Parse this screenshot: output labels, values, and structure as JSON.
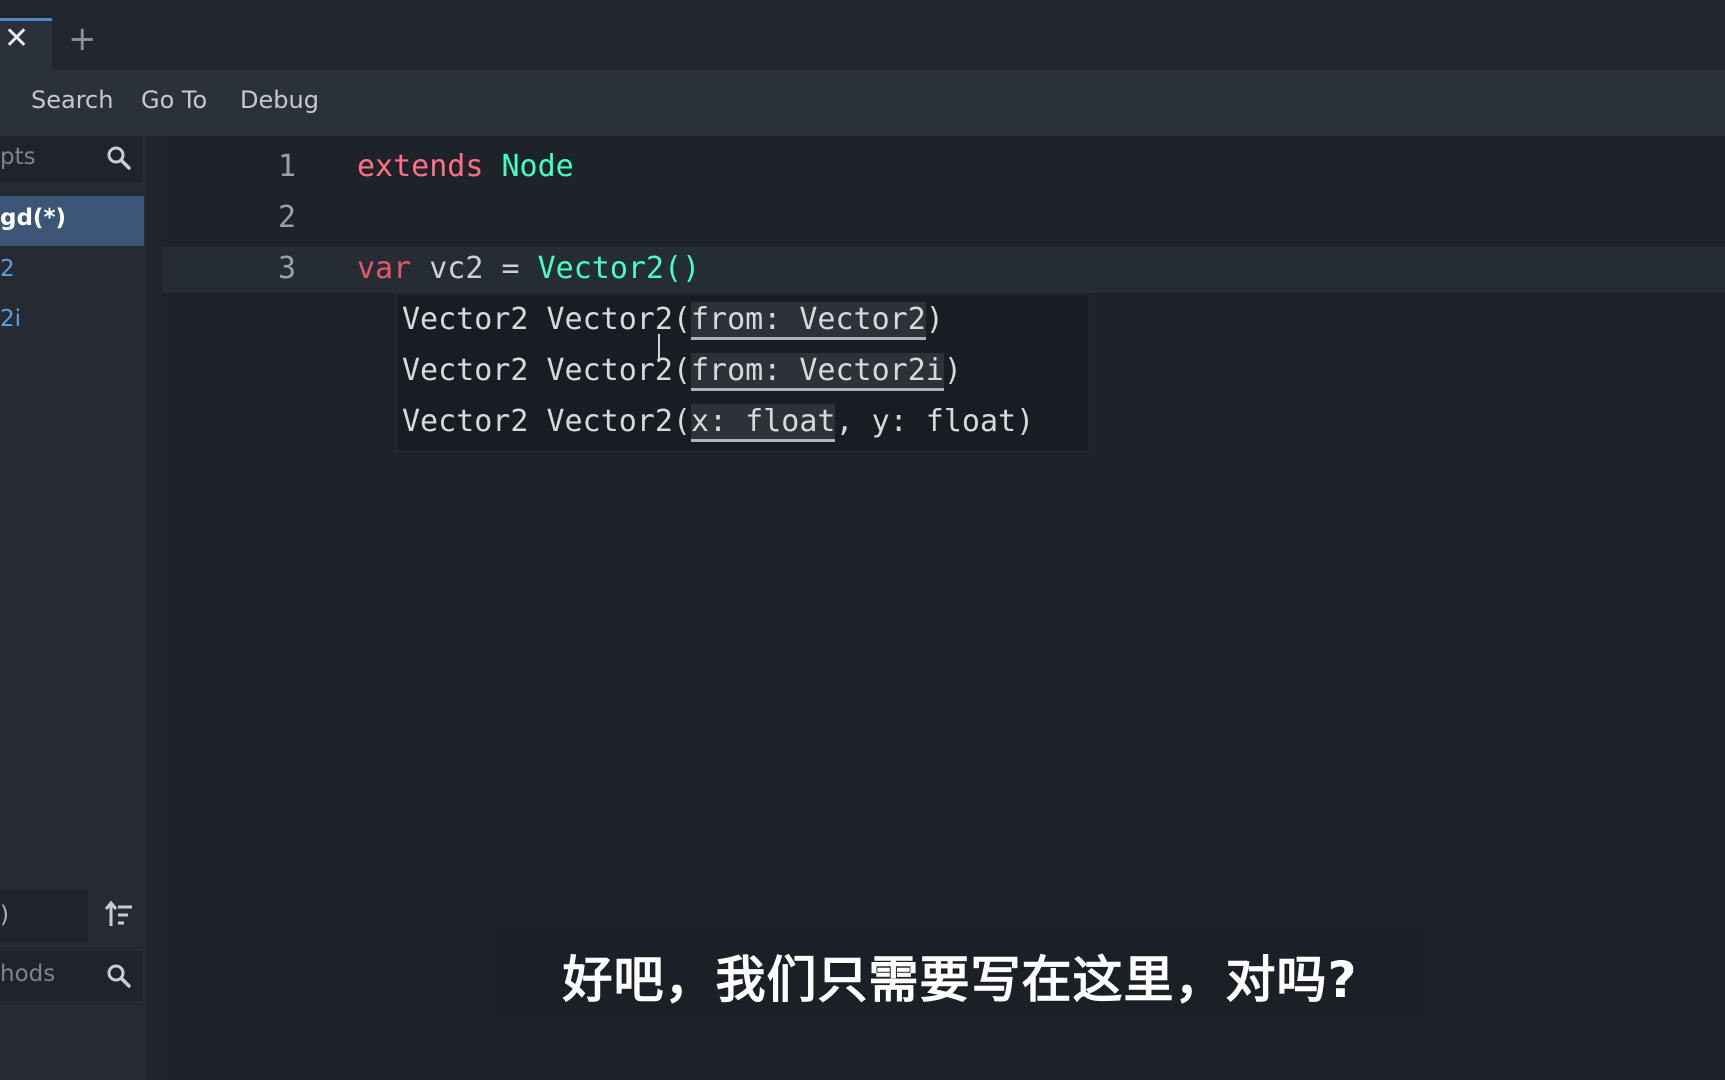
{
  "tabs": {
    "close_glyph": "✕",
    "add_glyph": "+"
  },
  "menu": {
    "items": [
      "Search",
      "Go To",
      "Debug"
    ]
  },
  "left_panel": {
    "scripts_filter": "pts",
    "scripts": [
      {
        "label": "gd(*)",
        "selected": true
      },
      {
        "label": "2",
        "selected": false
      },
      {
        "label": "2i",
        "selected": false
      }
    ],
    "bottom_field": ")",
    "methods_filter": "hods"
  },
  "editor": {
    "lines": [
      {
        "number": "1"
      },
      {
        "number": "2"
      },
      {
        "number": "3"
      }
    ],
    "line1": {
      "keyword": "extends",
      "type": "Node"
    },
    "line3": {
      "keyword": "var",
      "name": " vc2 = ",
      "call": "Vector2()"
    }
  },
  "tooltip": {
    "rows": [
      {
        "prefix": "Vector2 Vector2(",
        "arg": "from: Vector2",
        "rest": ")"
      },
      {
        "prefix": "Vector2 Vector2(",
        "arg": "from: Vector2i",
        "rest": ")"
      },
      {
        "prefix": "Vector2 Vector2(",
        "arg": "x: float",
        "rest": ", y: float)"
      }
    ]
  },
  "subtitle": "好吧，我们只需要写在这里，对吗?",
  "colors": {
    "keyword": "#ff7086",
    "type": "#42ffc2",
    "selection": "#3d5677"
  }
}
